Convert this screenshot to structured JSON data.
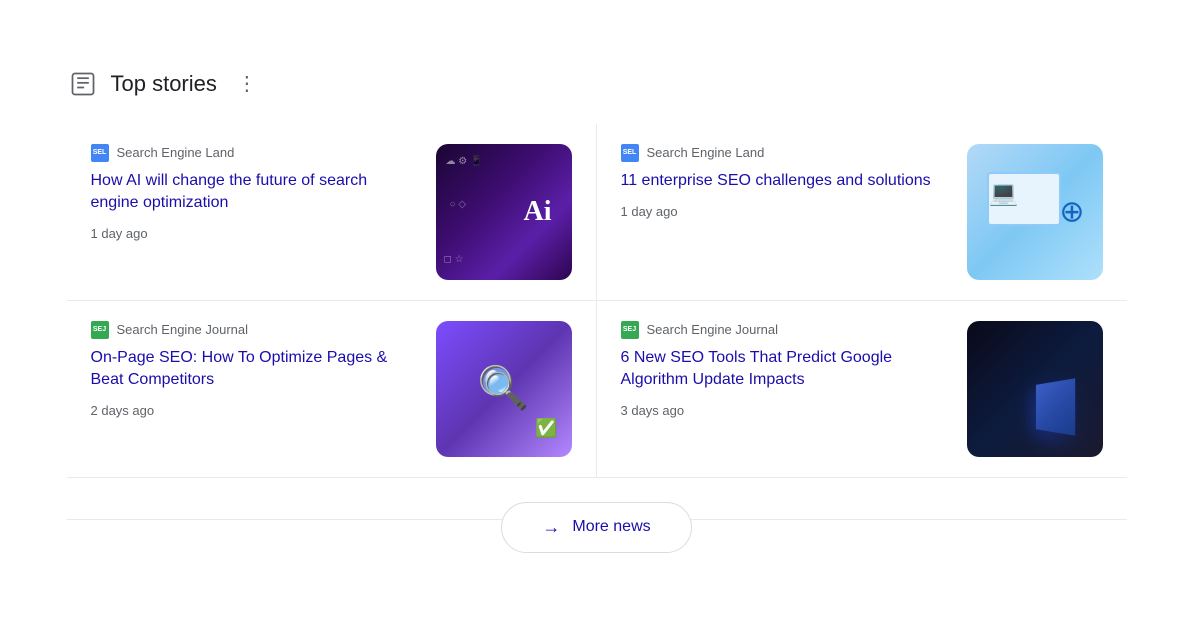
{
  "header": {
    "title": "Top stories",
    "icon": "newspaper-icon",
    "more_options_label": "⋮"
  },
  "stories": [
    {
      "id": "story-1",
      "source_name": "Search Engine Land",
      "source_type": "sel",
      "source_logo_text": "SEL",
      "title": "How AI will change the future of search engine optimization",
      "time_ago": "1 day ago",
      "image_type": "img-ai"
    },
    {
      "id": "story-2",
      "source_name": "Search Engine Land",
      "source_type": "sel",
      "source_logo_text": "SEL",
      "title": "11 enterprise SEO challenges and solutions",
      "time_ago": "1 day ago",
      "image_type": "img-seo-challenges"
    },
    {
      "id": "story-3",
      "source_name": "Search Engine Journal",
      "source_type": "sej",
      "source_logo_text": "SEJ",
      "title": "On-Page SEO: How To Optimize Pages & Beat Competitors",
      "time_ago": "2 days ago",
      "image_type": "img-onpage"
    },
    {
      "id": "story-4",
      "source_name": "Search Engine Journal",
      "source_type": "sej",
      "source_logo_text": "SEJ",
      "title": "6 New SEO Tools That Predict Google Algorithm Update Impacts",
      "time_ago": "3 days ago",
      "image_type": "img-dark"
    }
  ],
  "more_news": {
    "label": "More news",
    "arrow": "→"
  }
}
